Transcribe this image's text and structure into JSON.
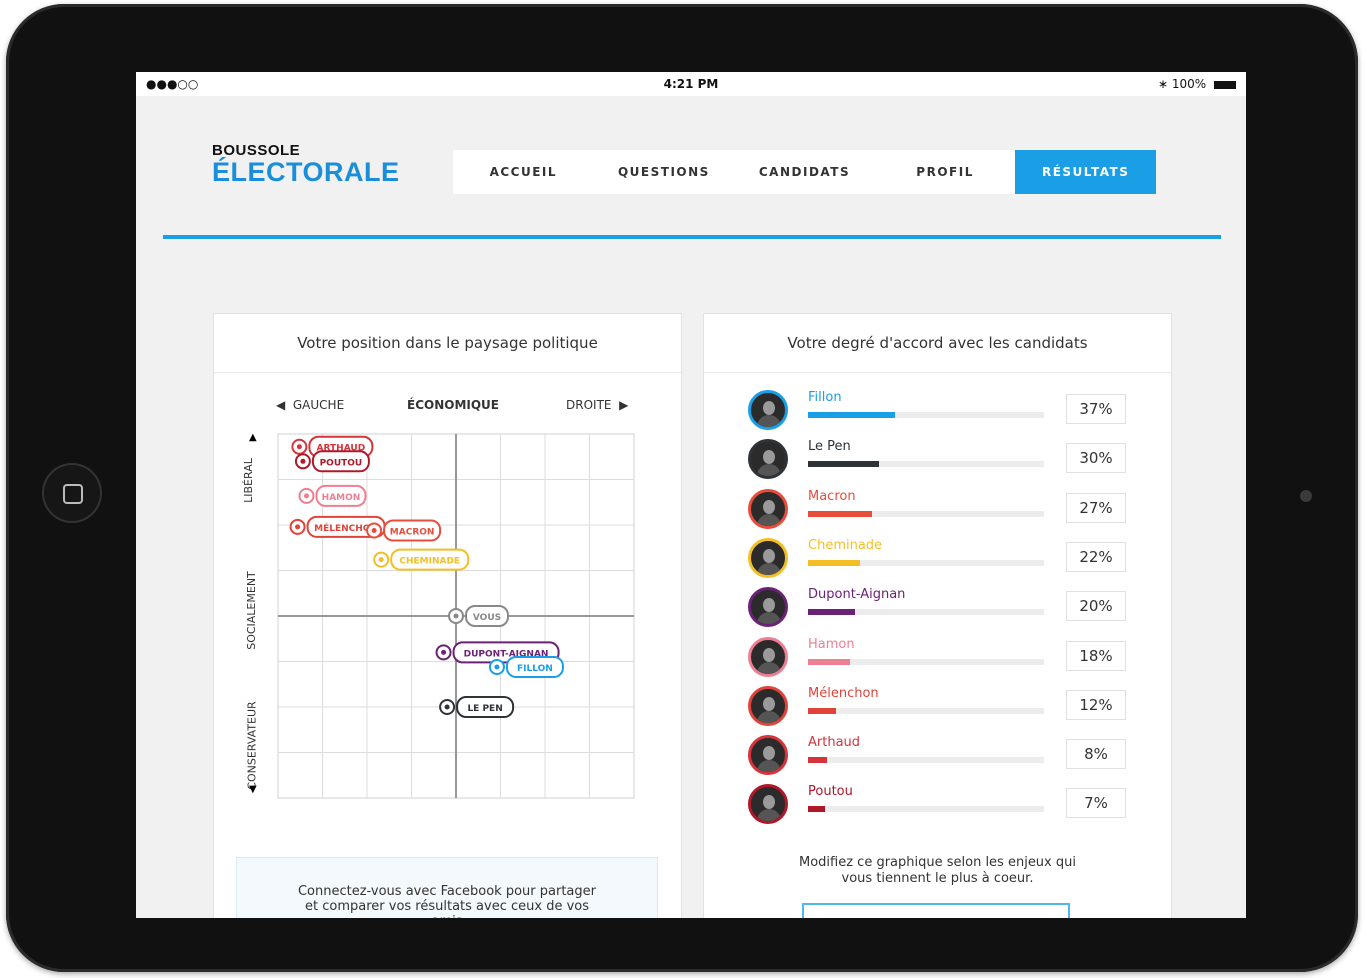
{
  "status": {
    "signal": "●●●○○",
    "time": "4:21 PM",
    "battery": "100%"
  },
  "logo": {
    "line1": "BOUSSOLE",
    "line2": "ÉLECTORALE"
  },
  "nav": [
    "ACCUEIL",
    "QUESTIONS",
    "CANDIDATS",
    "PROFIL",
    "RÉSULTATS"
  ],
  "nav_active": "RÉSULTATS",
  "position": {
    "title": "Votre position dans le paysage politique",
    "axis_left": "GAUCHE",
    "axis_center": "ÉCONOMIQUE",
    "axis_right": "DROITE",
    "axis_top": "LIBÉRAL",
    "axis_mid": "SOCIALEMENT",
    "axis_bottom": "CONSERVATEUR"
  },
  "chart_data": {
    "type": "scatter",
    "xlim": [
      -1,
      1
    ],
    "ylim": [
      -1,
      1
    ],
    "grid": true,
    "points": [
      {
        "name": "ARTHAUD",
        "x": -0.88,
        "y": 0.93,
        "color": "#d6333b"
      },
      {
        "name": "POUTOU",
        "x": -0.86,
        "y": 0.85,
        "color": "#b0182a"
      },
      {
        "name": "HAMON",
        "x": -0.84,
        "y": 0.66,
        "color": "#ee7f92"
      },
      {
        "name": "MÉLENCHON",
        "x": -0.89,
        "y": 0.49,
        "color": "#e0433a"
      },
      {
        "name": "MACRON",
        "x": -0.46,
        "y": 0.47,
        "color": "#e84d3b"
      },
      {
        "name": "CHEMINADE",
        "x": -0.42,
        "y": 0.31,
        "color": "#f4bf24"
      },
      {
        "name": "VOUS",
        "x": 0.0,
        "y": 0.0,
        "color": "#888888"
      },
      {
        "name": "DUPONT-AIGNAN",
        "x": -0.07,
        "y": -0.2,
        "color": "#6b2175"
      },
      {
        "name": "FILLON",
        "x": 0.23,
        "y": -0.28,
        "color": "#1a9ee5"
      },
      {
        "name": "LE PEN",
        "x": -0.05,
        "y": -0.5,
        "color": "#2e3338"
      }
    ]
  },
  "facebook": {
    "text": "Connectez-vous avec Facebook pour partager et comparer vos résultats avec ceux de vos amis"
  },
  "agreement": {
    "title": "Votre degré d'accord avec les candidats",
    "candidates": [
      {
        "name": "Fillon",
        "pct": "37%",
        "value": 37,
        "color": "#1a9ee5"
      },
      {
        "name": "Le Pen",
        "pct": "30%",
        "value": 30,
        "color": "#2e3338"
      },
      {
        "name": "Macron",
        "pct": "27%",
        "value": 27,
        "color": "#e84d3b"
      },
      {
        "name": "Cheminade",
        "pct": "22%",
        "value": 22,
        "color": "#f4bf24"
      },
      {
        "name": "Dupont-Aignan",
        "pct": "20%",
        "value": 20,
        "color": "#6b2175"
      },
      {
        "name": "Hamon",
        "pct": "18%",
        "value": 18,
        "color": "#ee7f92"
      },
      {
        "name": "Mélenchon",
        "pct": "12%",
        "value": 12,
        "color": "#e0433a"
      },
      {
        "name": "Arthaud",
        "pct": "8%",
        "value": 8,
        "color": "#d6333b"
      },
      {
        "name": "Poutou",
        "pct": "7%",
        "value": 7,
        "color": "#b0182a"
      }
    ],
    "modify_text": "Modifiez ce graphique selon les enjeux qui vous tiennent le plus à coeur."
  }
}
